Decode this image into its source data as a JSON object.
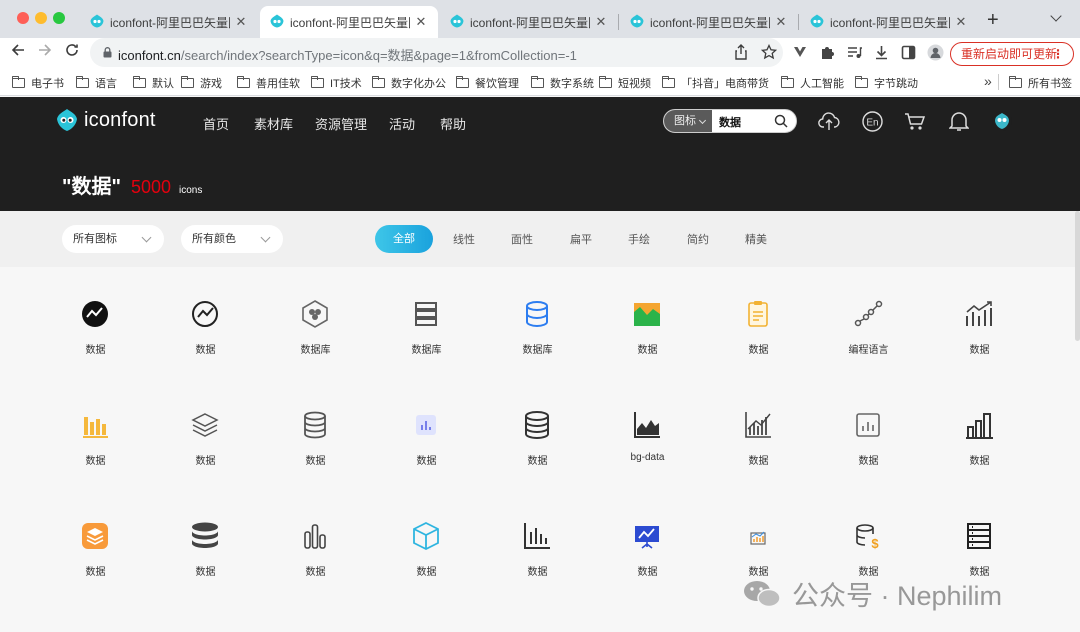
{
  "tabs": [
    {
      "title": "iconfont-阿里巴巴矢量图标库",
      "active": false
    },
    {
      "title": "iconfont-阿里巴巴矢量图标库",
      "active": true
    },
    {
      "title": "iconfont-阿里巴巴矢量图标库",
      "active": false
    },
    {
      "title": "iconfont-阿里巴巴矢量图标库",
      "active": false
    },
    {
      "title": "iconfont-阿里巴巴矢量图标库",
      "active": false
    }
  ],
  "tab_close": "✕",
  "new_tab": "+",
  "url": {
    "host": "iconfont.cn",
    "path": "/search/index?searchType=icon&q=数据&page=1&fromCollection=-1"
  },
  "update_button": "重新启动即可更新",
  "bookmarks": [
    "电子书",
    "语言",
    "默认",
    "游戏",
    "善用佳软",
    "IT技术",
    "数字化办公",
    "餐饮管理",
    "数字系统",
    "短视频",
    "「抖音」电商带货",
    "人工智能",
    "字节跳动"
  ],
  "bookmarks_overflow": "»",
  "all_bookmarks": "所有书签",
  "site": {
    "logo": "iconfont",
    "nav": [
      "首页",
      "素材库",
      "资源管理",
      "活动",
      "帮助"
    ],
    "search_type": "图标",
    "search_query": "数据",
    "result_query": "\"数据\"",
    "result_count": "5000",
    "result_unit": "icons"
  },
  "filters": {
    "dropdowns": [
      "所有图标",
      "所有颜色"
    ],
    "styles": [
      "全部",
      "线性",
      "面性",
      "扁平",
      "手绘",
      "简约",
      "精美"
    ],
    "active_style": "全部"
  },
  "icons": [
    {
      "label": "数据",
      "icon": "pulse-circle-filled-icon"
    },
    {
      "label": "数据",
      "icon": "pulse-circle-outline-icon"
    },
    {
      "label": "数据库",
      "icon": "hexagon-db-icon"
    },
    {
      "label": "数据库",
      "icon": "server-stack-icon"
    },
    {
      "label": "数据库",
      "icon": "database-blue-icon"
    },
    {
      "label": "数据",
      "icon": "color-chart-icon"
    },
    {
      "label": "数据",
      "icon": "clipboard-yellow-icon"
    },
    {
      "label": "编程语言",
      "icon": "node-line-icon"
    },
    {
      "label": "数据",
      "icon": "trend-bars-icon"
    },
    {
      "label": "数据",
      "icon": "yellow-bars-icon"
    },
    {
      "label": "数据",
      "icon": "layers-icon"
    },
    {
      "label": "数据",
      "icon": "db-outline-icon"
    },
    {
      "label": "数据",
      "icon": "lavender-chart-icon"
    },
    {
      "label": "数据",
      "icon": "db-stack-icon"
    },
    {
      "label": "bg-data",
      "icon": "area-chart-icon"
    },
    {
      "label": "数据",
      "icon": "bar-trend-icon"
    },
    {
      "label": "数据",
      "icon": "chart-box-icon"
    },
    {
      "label": "数据",
      "icon": "bar-outline-icon"
    },
    {
      "label": "数据",
      "icon": "orange-stack-icon"
    },
    {
      "label": "数据",
      "icon": "db-solid-icon"
    },
    {
      "label": "数据",
      "icon": "three-bars-icon"
    },
    {
      "label": "数据",
      "icon": "cube-icon"
    },
    {
      "label": "数据",
      "icon": "axis-bars-icon"
    },
    {
      "label": "数据",
      "icon": "presentation-icon"
    },
    {
      "label": "数据",
      "icon": "small-chart-icon"
    },
    {
      "label": "数据",
      "icon": "db-dollar-icon"
    },
    {
      "label": "数据",
      "icon": "list-table-icon"
    }
  ],
  "watermark": "公众号 · Nephilim",
  "colors": {
    "accent": "#1aa2dd",
    "brand_red": "#e3000e",
    "header_bg": "#1f1f1f"
  }
}
